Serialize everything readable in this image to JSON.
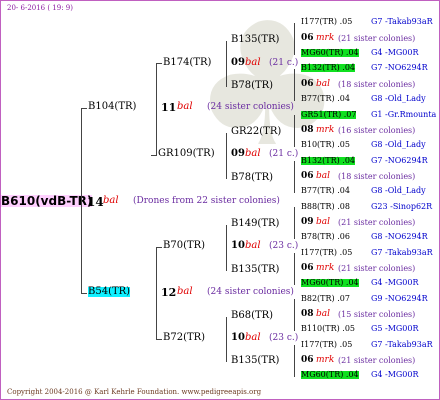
{
  "header": {
    "date": "20- 6-2016 ( 19: 9)"
  },
  "footer": {
    "copyright": "Copyright 2004-2016 @ Karl Kehrle Foundation.   www.pedigreeapis.org"
  },
  "root": {
    "id": "B610(vdB-TR)",
    "num": "14",
    "bal": "bal",
    "note": "(Drones from 22 sister colonies)"
  },
  "gen1": [
    {
      "id": "B104(TR)",
      "num": "11",
      "bal": "bal",
      "note": "(24 sister colonies)"
    },
    {
      "id": "B54(TR)",
      "num": "12",
      "bal": "bal",
      "note": "(24 sister colonies)"
    }
  ],
  "gen2": [
    {
      "id": "B174(TR)",
      "num": "09",
      "bal": "bal",
      "note": "(21 c.)"
    },
    {
      "id": "GR109(TR)",
      "num": "09",
      "bal": "bal",
      "note": "(21 c.)"
    },
    {
      "id": "B70(TR)",
      "num": "10",
      "bal": "bal",
      "note": "(23 c.)"
    },
    {
      "id": "B72(TR)",
      "num": "10",
      "bal": "bal",
      "note": "(23 c.)"
    }
  ],
  "gen3": [
    {
      "id": "B135(TR)"
    },
    {
      "id": "B78(TR)"
    },
    {
      "id": "GR22(TR)"
    },
    {
      "id": "B78(TR)"
    },
    {
      "id": "B149(TR)"
    },
    {
      "id": "B135(TR)"
    },
    {
      "id": "B68(TR)"
    },
    {
      "id": "B135(TR)"
    }
  ],
  "gen4": [
    {
      "id": "I177(TR) .05",
      "right": "G7 -Takab93aR"
    },
    {
      "id": "06",
      "mrk": "mrk",
      "note": "(21 sister colonies)"
    },
    {
      "id": "MG60(TR) .04",
      "right": "G4 -MG00R"
    },
    {
      "id": "B132(TR) .04",
      "right": "G7 -NO6294R"
    },
    {
      "id": "06",
      "mrk": "bal",
      "note": "(18 sister colonies)"
    },
    {
      "id": "B77(TR) .04",
      "right": "G8 -Old_Lady"
    },
    {
      "id": "GR51(TR) .07",
      "right": "G1 -Gr.Rmounta"
    },
    {
      "id": "08",
      "mrk": "mrk",
      "note": "(16 sister colonies)"
    },
    {
      "id": "B10(TR) .05",
      "right": "G8 -Old_Lady"
    },
    {
      "id": "B132(TR) .04",
      "right": "G7 -NO6294R"
    },
    {
      "id": "06",
      "mrk": "bal",
      "note": "(18 sister colonies)"
    },
    {
      "id": "B77(TR) .04",
      "right": "G8 -Old_Lady"
    },
    {
      "id": "B88(TR) .08",
      "right": "G23 -Sinop62R"
    },
    {
      "id": "09",
      "mrk": "bal",
      "note": "(21 sister colonies)"
    },
    {
      "id": "B78(TR) .06",
      "right": "G8 -NO6294R"
    },
    {
      "id": "I177(TR) .05",
      "right": "G7 -Takab93aR"
    },
    {
      "id": "06",
      "mrk": "mrk",
      "note": "(21 sister colonies)"
    },
    {
      "id": "MG60(TR) .04",
      "right": "G4 -MG00R"
    },
    {
      "id": "B82(TR) .07",
      "right": "G9 -NO6294R"
    },
    {
      "id": "08",
      "mrk": "bal",
      "note": "(15 sister colonies)"
    },
    {
      "id": "B110(TR) .05",
      "right": "G5 -MG00R"
    },
    {
      "id": "I177(TR) .05",
      "right": "G7 -Takab93aR"
    },
    {
      "id": "06",
      "mrk": "mrk",
      "note": "(21 sister colonies)"
    },
    {
      "id": "MG60(TR) .04",
      "right": "G4 -MG00R"
    }
  ]
}
